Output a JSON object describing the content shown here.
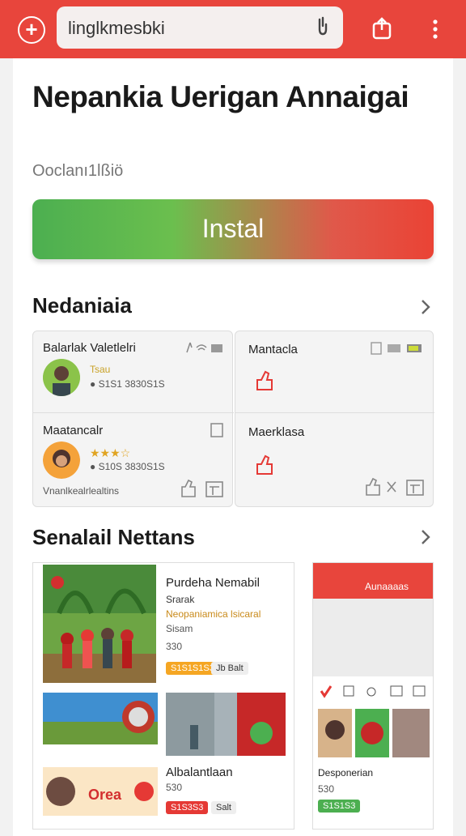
{
  "toolbar": {
    "url": "linglkmesbki",
    "icons": [
      "plus-icon",
      "mic-icon",
      "share-icon",
      "more-icon"
    ]
  },
  "app": {
    "title": "Nepankia Uerigan Annaigai",
    "subtitle": "Ooclanı1lßiö",
    "install_label": "Instal"
  },
  "section1": {
    "title": "Nedaniaia",
    "cards": [
      {
        "name": "Balarlak Valetlelri",
        "rating": "Tsau",
        "meta": "● S1S1 3830S1S"
      },
      {
        "name": "Mantacla"
      },
      {
        "name": "Maatancalr",
        "rating": "★★★☆",
        "meta": "● S10S 3830S1S"
      },
      {
        "name": "Maerklasa"
      }
    ],
    "footer": "Vnanlkealrlealtins"
  },
  "section2": {
    "title": "Senalail Nettans",
    "shot1": {
      "title": "Purdeha Nemabil",
      "line1": "Srarak",
      "line2": "Neopaniamica lsicaral",
      "line3": "Sisam",
      "price": "330",
      "tag1": "S1S1S1S3",
      "tag2": "Jb Balt",
      "bottom_title": "Albalantlaan",
      "bottom_price": "530",
      "tag3": "S1S3S3",
      "tag4": "Salt",
      "promo": "Orea"
    },
    "shot2": {
      "header": "Aunaaaas",
      "caption": "Desponerian",
      "price": "530",
      "tag": "S1S1S3"
    }
  },
  "colors": {
    "brand": "#e8453c",
    "green": "#4caf50"
  }
}
